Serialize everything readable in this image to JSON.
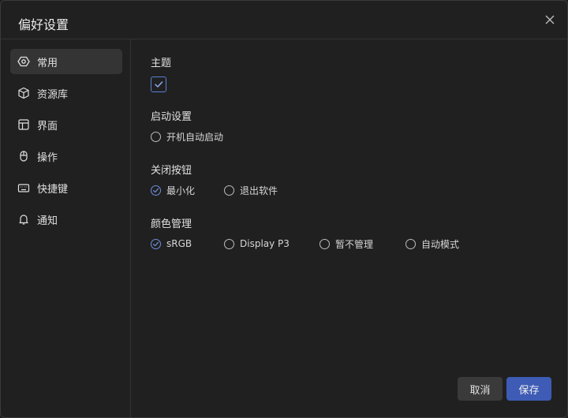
{
  "dialog": {
    "title": "偏好设置"
  },
  "sidebar": {
    "items": [
      {
        "label": "常用",
        "icon": "gear-hex-icon",
        "active": true
      },
      {
        "label": "资源库",
        "icon": "cube-icon"
      },
      {
        "label": "界面",
        "icon": "layout-icon"
      },
      {
        "label": "操作",
        "icon": "mouse-icon"
      },
      {
        "label": "快捷键",
        "icon": "keyboard-icon"
      },
      {
        "label": "通知",
        "icon": "bell-icon"
      }
    ]
  },
  "settings": {
    "theme": {
      "title": "主题",
      "checked": true
    },
    "startup": {
      "title": "启动设置",
      "options": [
        "开机自动启动"
      ],
      "selected": null
    },
    "close_button": {
      "title": "关闭按钮",
      "options": [
        "最小化",
        "退出软件"
      ],
      "selected": "最小化"
    },
    "color_management": {
      "title": "颜色管理",
      "options": [
        "sRGB",
        "Display P3",
        "暂不管理",
        "自动模式"
      ],
      "selected": "sRGB"
    }
  },
  "footer": {
    "cancel_label": "取消",
    "save_label": "保存"
  },
  "colors": {
    "accent": "#3e5bb5",
    "background": "#202020",
    "active_item": "#343434"
  }
}
